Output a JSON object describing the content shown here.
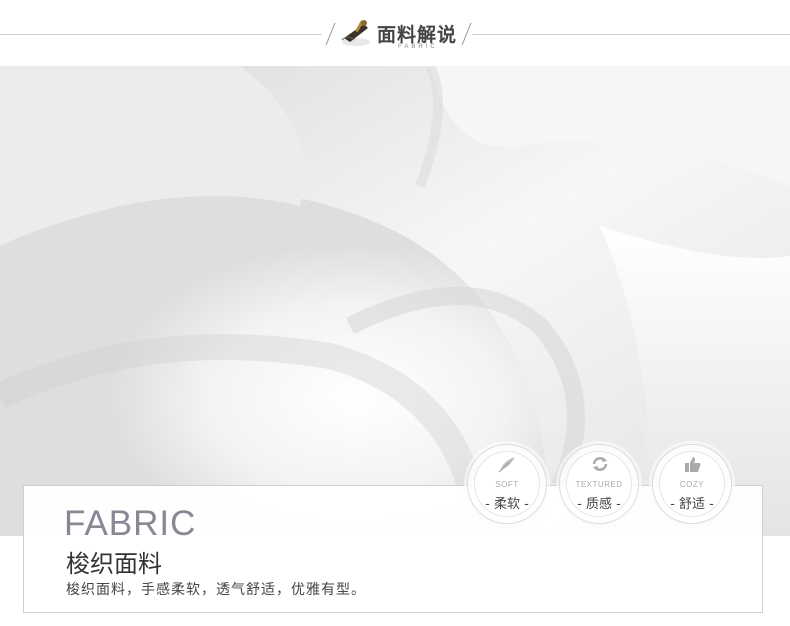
{
  "header": {
    "title": "面料解说",
    "subtitle": "FABRIC"
  },
  "card": {
    "title_en": "FABRIC",
    "title_cn": "梭织面料",
    "description": "梭织面料，手感柔软，透气舒适，优雅有型。"
  },
  "badges": [
    {
      "icon": "feather-icon",
      "en": "SOFT",
      "cn": "- 柔软 -"
    },
    {
      "icon": "refresh-icon",
      "en": "TEXTURED",
      "cn": "- 质感 -"
    },
    {
      "icon": "thumbs-up-icon",
      "en": "COZY",
      "cn": "- 舒适 -"
    }
  ],
  "colors": {
    "title_en": "#8a8694",
    "text": "#333333",
    "line": "#cfcfcf"
  }
}
